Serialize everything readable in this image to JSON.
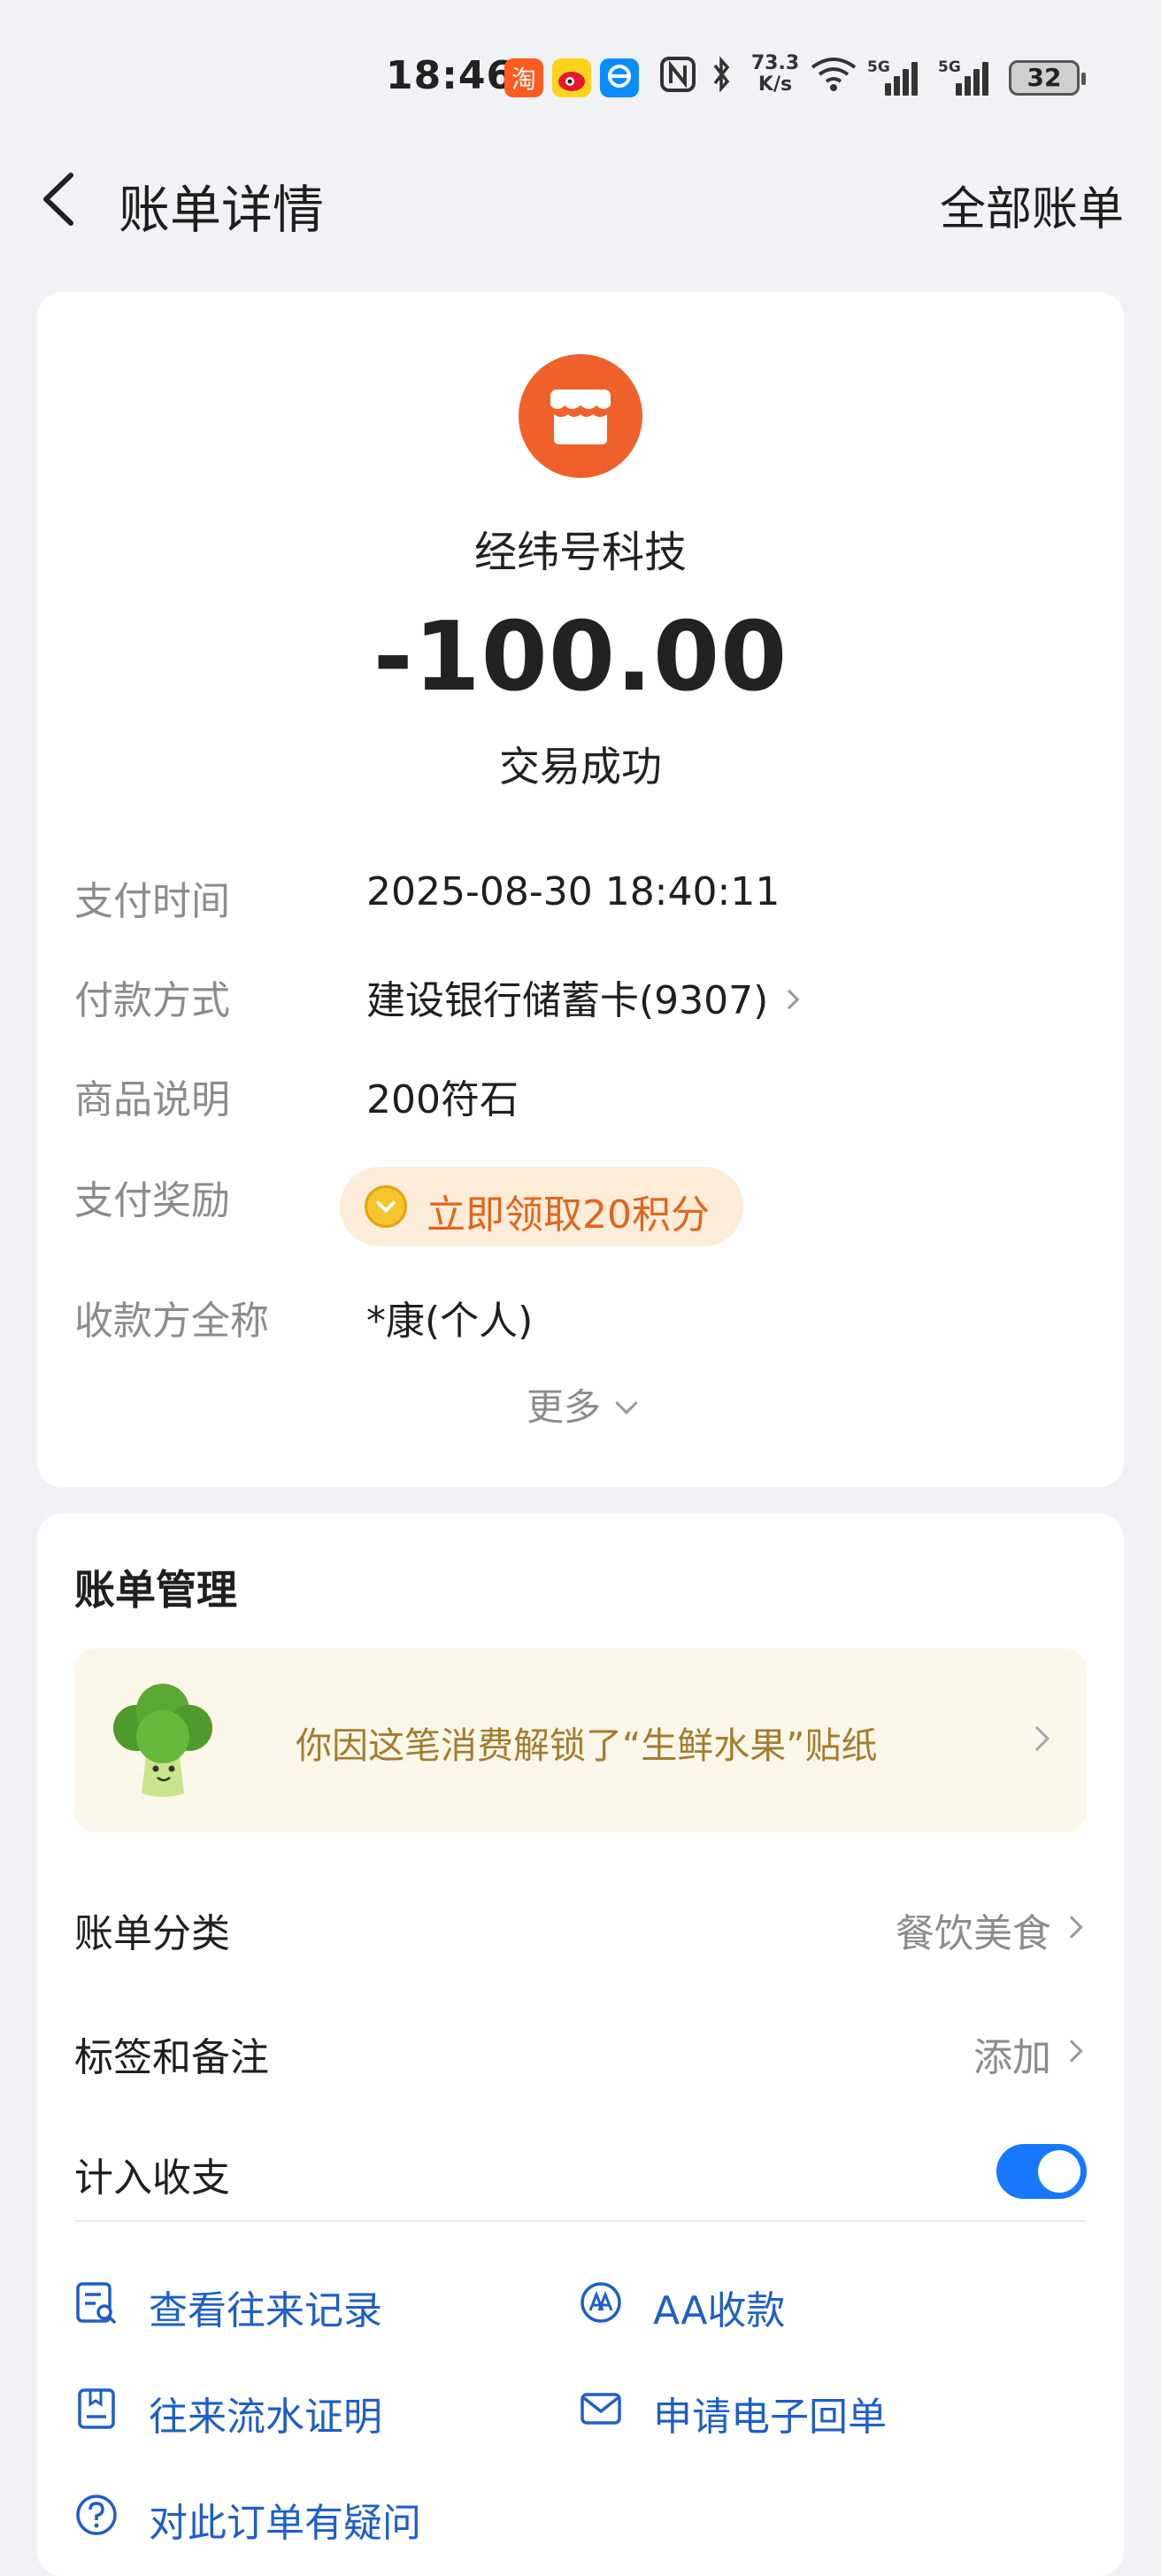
{
  "status_bar": {
    "time": "18:46",
    "speed_value": "73.3",
    "speed_unit": "K/s",
    "signal_label_1": "5G",
    "signal_label_2": "5G",
    "battery": "32",
    "icons": [
      "taobao-app-icon",
      "weibo-app-icon",
      "eleme-app-icon",
      "nfc-icon",
      "bluetooth-icon",
      "wifi-icon",
      "signal-icon",
      "signal-icon",
      "battery-icon"
    ]
  },
  "nav": {
    "title": "账单详情",
    "right_link": "全部账单"
  },
  "bill": {
    "merchant": "经纬号科技",
    "amount": "-100.00",
    "status": "交易成功",
    "details": [
      {
        "label": "支付时间",
        "value": "2025-08-30 18:40:11"
      },
      {
        "label": "付款方式",
        "value": "建设银行储蓄卡(9307)"
      },
      {
        "label": "商品说明",
        "value": "200符石"
      },
      {
        "label": "支付奖励",
        "value": "立即领取20积分"
      },
      {
        "label": "收款方全称",
        "value": "*康(个人)"
      }
    ],
    "more": "更多"
  },
  "management": {
    "title": "账单管理",
    "sticker_text": "你因这笔消费解锁了“生鲜水果”贴纸",
    "category_label": "账单分类",
    "category_value": "餐饮美食",
    "tags_label": "标签和备注",
    "tags_value": "添加",
    "include_label": "计入收支",
    "include_enabled": true,
    "actions": [
      {
        "label": "查看往来记录",
        "icon": "record-search-icon"
      },
      {
        "label": "AA收款",
        "icon": "aa-icon"
      },
      {
        "label": "往来流水证明",
        "icon": "statement-icon"
      },
      {
        "label": "申请电子回单",
        "icon": "mail-icon"
      },
      {
        "label": "对此订单有疑问",
        "icon": "question-icon"
      }
    ]
  },
  "colors": {
    "accent_blue": "#1677ff",
    "merchant_orange": "#f0602a",
    "reward_orange": "#e0661c",
    "sticker_gold": "#a27d2f"
  }
}
